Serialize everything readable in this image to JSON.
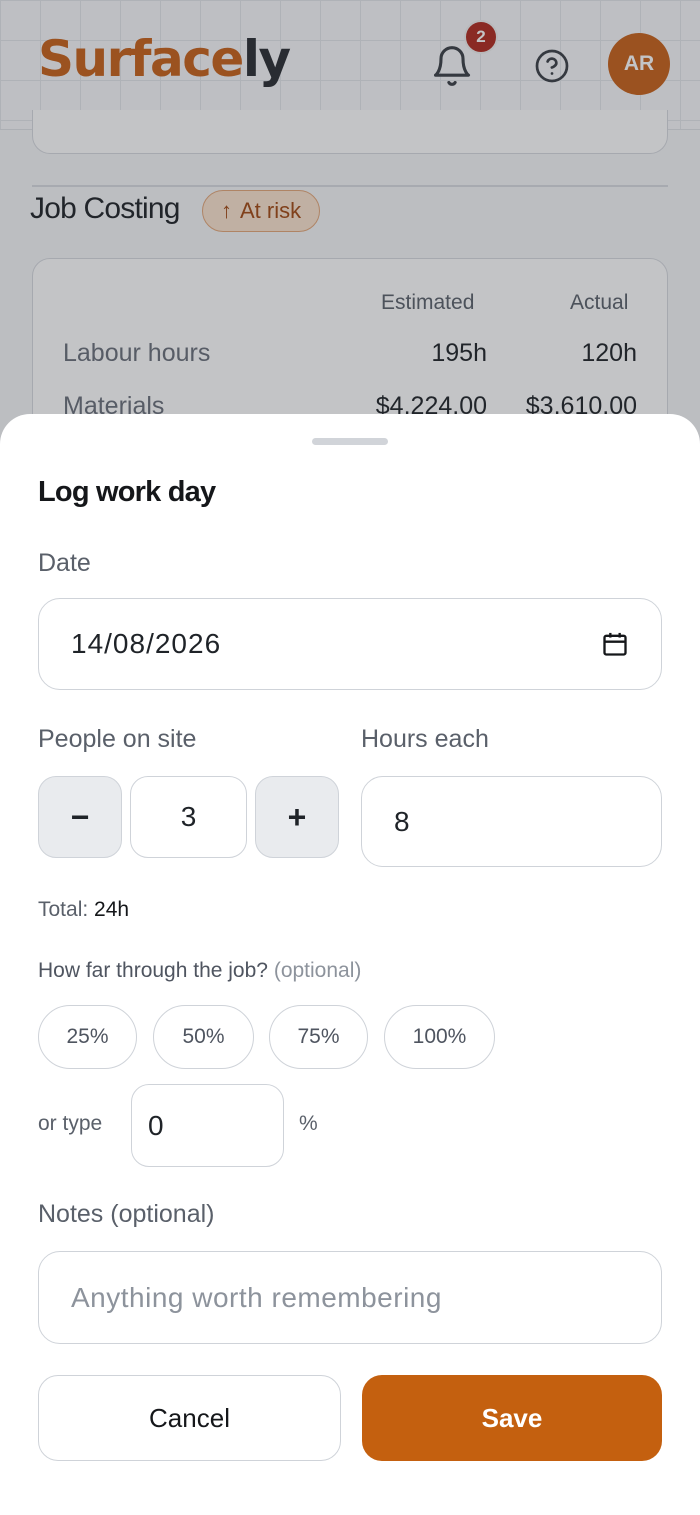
{
  "header": {
    "logo_part1": "Surface",
    "logo_part2": "ly",
    "notification_count": "2",
    "avatar_initials": "AR",
    "icons": [
      "bell-icon",
      "help-icon"
    ]
  },
  "background": {
    "section_title": "Job Costing",
    "status_badge": "At risk",
    "costing": {
      "columns": [
        "Estimated",
        "Actual"
      ],
      "rows": [
        {
          "label": "Labour hours",
          "estimated": "195h",
          "actual": "120h"
        },
        {
          "label": "Materials",
          "estimated": "$4,224.00",
          "actual": "$3,610.00"
        }
      ]
    }
  },
  "sheet": {
    "title": "Log work day",
    "date_label": "Date",
    "date_value": "14/08/2026",
    "people_label": "People on site",
    "people_value": "3",
    "minus": "−",
    "plus": "+",
    "hours_label": "Hours each",
    "hours_value": "8",
    "total_label": "Total:",
    "total_value": "24h",
    "progress_question": "How far through the job?",
    "progress_optional": "(optional)",
    "progress_options": [
      "25%",
      "50%",
      "75%",
      "100%"
    ],
    "or_type": "or type",
    "percent_value": "0",
    "percent_sign": "%",
    "notes_label": "Notes (optional)",
    "notes_placeholder": "Anything worth remembering",
    "cancel_label": "Cancel",
    "save_label": "Save"
  },
  "colors": {
    "accent": "#c4600f",
    "badge": "#b12a1f",
    "risk_bg": "#fbe3cf"
  }
}
